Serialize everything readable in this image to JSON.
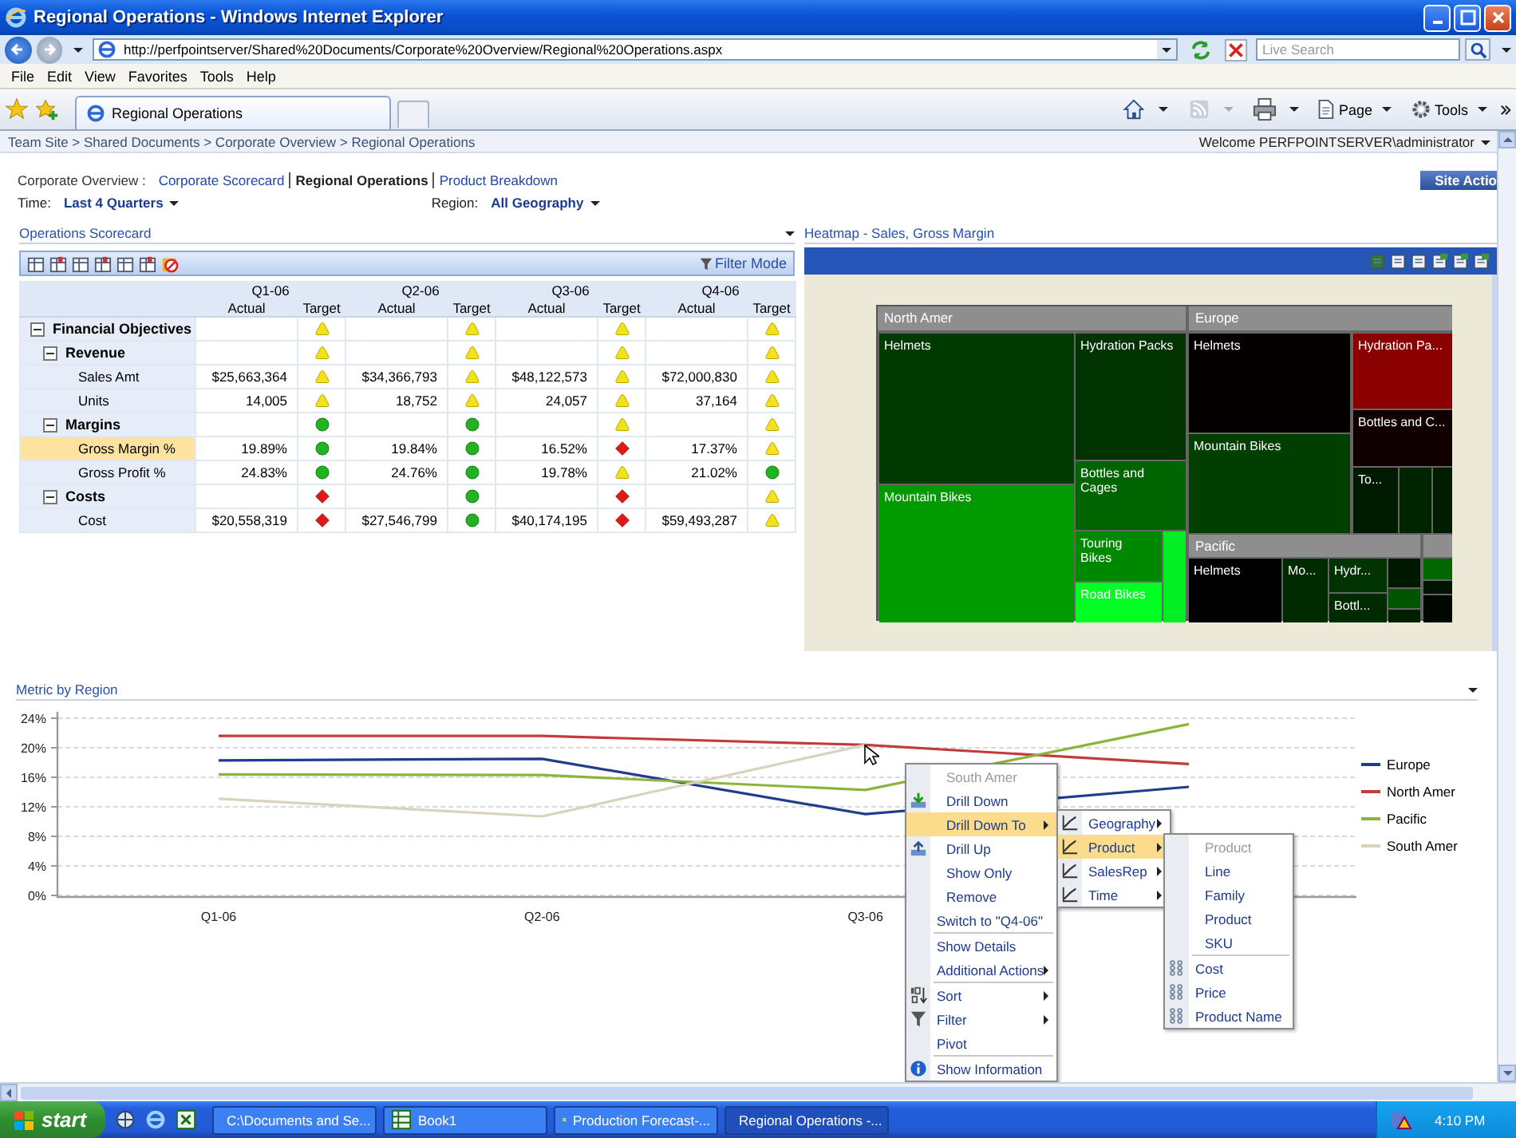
{
  "window": {
    "title": "Regional Operations - Windows Internet Explorer"
  },
  "address_bar": {
    "url": "http://perfpointserver/Shared%20Documents/Corporate%20Overview/Regional%20Operations.aspx"
  },
  "search": {
    "placeholder": "Live Search"
  },
  "menu": [
    "File",
    "Edit",
    "View",
    "Favorites",
    "Tools",
    "Help"
  ],
  "tabs": [
    {
      "label": "Regional Operations",
      "selected": true
    }
  ],
  "command_bar": [
    "Page",
    "Tools"
  ],
  "breadcrumb": "Team Site > Shared Documents > Corporate Overview > Regional Operations",
  "welcome": "Welcome PERFPOINTSERVER\\administrator",
  "site_actions": "Site Actio",
  "page_nav": {
    "label": "Corporate Overview :",
    "links": [
      {
        "label": "Corporate Scorecard",
        "selected": false
      },
      {
        "label": "Regional Operations",
        "selected": true
      },
      {
        "label": "Product Breakdown",
        "selected": false
      }
    ]
  },
  "filters": [
    {
      "label": "Time:",
      "value": "Last 4 Quarters"
    },
    {
      "label": "Region:",
      "value": "All Geography"
    }
  ],
  "scorecard": {
    "title": "Operations Scorecard",
    "filter_mode": "Filter Mode",
    "periods": [
      {
        "label": "Q1-06",
        "columns": [
          "Actual",
          "Target"
        ]
      },
      {
        "label": "Q2-06",
        "columns": [
          "Actual",
          "Target"
        ]
      },
      {
        "label": "Q3-06",
        "columns": [
          "Actual",
          "Target"
        ]
      },
      {
        "label": "Q4-06",
        "columns": [
          "Actual",
          "Target"
        ]
      }
    ],
    "rows": [
      {
        "label": "Financial Objectives",
        "expanded": true,
        "selected": false,
        "cells": [
          {
            "kind": "warning"
          },
          {
            "kind": "warning"
          },
          {
            "kind": "warning"
          },
          {
            "kind": "warning"
          }
        ],
        "children": [
          {
            "label": "Revenue",
            "expanded": true,
            "selected": false,
            "cells": [
              {
                "kind": "warning"
              },
              {
                "kind": "warning"
              },
              {
                "kind": "warning"
              },
              {
                "kind": "warning"
              }
            ],
            "children": [
              {
                "label": "Sales Amt",
                "selected": false,
                "cells": [
                  {
                    "actual": "$25,663,364",
                    "kind": "warning"
                  },
                  {
                    "actual": "$34,366,793",
                    "kind": "warning"
                  },
                  {
                    "actual": "$48,122,573",
                    "kind": "warning"
                  },
                  {
                    "actual": "$72,000,830",
                    "kind": "warning"
                  }
                ]
              },
              {
                "label": "Units",
                "selected": false,
                "cells": [
                  {
                    "actual": "14,005",
                    "kind": "warning"
                  },
                  {
                    "actual": "18,752",
                    "kind": "warning"
                  },
                  {
                    "actual": "24,057",
                    "kind": "warning"
                  },
                  {
                    "actual": "37,164",
                    "kind": "warning"
                  }
                ]
              }
            ]
          },
          {
            "label": "Margins",
            "expanded": true,
            "selected": false,
            "cells": [
              {
                "kind": "good"
              },
              {
                "kind": "good"
              },
              {
                "kind": "warning"
              },
              {
                "kind": "warning"
              }
            ],
            "children": [
              {
                "label": "Gross Margin %",
                "selected": true,
                "cells": [
                  {
                    "actual": "19.89%",
                    "kind": "good"
                  },
                  {
                    "actual": "19.84%",
                    "kind": "good"
                  },
                  {
                    "actual": "16.52%",
                    "kind": "bad"
                  },
                  {
                    "actual": "17.37%",
                    "kind": "warning"
                  }
                ]
              },
              {
                "label": "Gross Profit %",
                "selected": false,
                "cells": [
                  {
                    "actual": "24.83%",
                    "kind": "good"
                  },
                  {
                    "actual": "24.76%",
                    "kind": "good"
                  },
                  {
                    "actual": "19.78%",
                    "kind": "warning"
                  },
                  {
                    "actual": "21.02%",
                    "kind": "good"
                  }
                ]
              }
            ]
          },
          {
            "label": "Costs",
            "expanded": true,
            "selected": false,
            "cells": [
              {
                "kind": "bad"
              },
              {
                "kind": "good"
              },
              {
                "kind": "bad"
              },
              {
                "kind": "warning"
              }
            ],
            "children": [
              {
                "label": "Cost",
                "selected": false,
                "cells": [
                  {
                    "actual": "$20,558,319",
                    "kind": "bad"
                  },
                  {
                    "actual": "$27,546,799",
                    "kind": "good"
                  },
                  {
                    "actual": "$40,174,195",
                    "kind": "bad"
                  },
                  {
                    "actual": "$59,493,287",
                    "kind": "warning"
                  }
                ]
              }
            ]
          }
        ]
      }
    ]
  },
  "heatmap": {
    "title": "Heatmap - Sales, Gross Margin",
    "regions": [
      {
        "label": "North Amer",
        "cells": [
          {
            "label": "Helmets",
            "color": "#003a00"
          },
          {
            "label": "Hydration Packs",
            "color": "#003300"
          },
          {
            "label": "Bottles and Cages",
            "color": "#006400"
          },
          {
            "label": "Mountain Bikes",
            "color": "#009900"
          },
          {
            "label": "Touring Bikes",
            "color": "#008800"
          },
          {
            "color": "#00ee22"
          },
          {
            "label": "Road Bikes",
            "color": "#00ff22"
          }
        ]
      },
      {
        "label": "Europe",
        "cells": [
          {
            "label": "Helmets",
            "color": "#050000"
          },
          {
            "label": "Hydration Pa...",
            "color": "#8b0000"
          },
          {
            "label": "Bottles and C...",
            "color": "#100000"
          },
          {
            "label": "Mountain Bikes",
            "color": "#003f00"
          },
          {
            "label": "To...",
            "color": "#001a00"
          },
          {
            "color": "#002400"
          },
          {
            "color": "#001d00"
          }
        ]
      },
      {
        "label": "Pacific",
        "cells": [
          {
            "label": "Helmets",
            "color": "#000000"
          },
          {
            "label": "Mo...",
            "color": "#002a00"
          },
          {
            "label": "Hydr...",
            "color": "#003300"
          },
          {
            "color": "#001800"
          },
          {
            "color": "#005500"
          },
          {
            "label": "Bottl...",
            "color": "#002a00"
          },
          {
            "color": "#002000"
          }
        ]
      },
      {
        "cells": [
          {
            "color": "#006600"
          },
          {
            "color": "#001500"
          },
          {
            "color": "#000800"
          }
        ]
      }
    ]
  },
  "metric_chart": {
    "title": "Metric by Region",
    "chart_data": {
      "type": "line",
      "categories": [
        "Q1-06",
        "Q2-06",
        "Q3-06",
        null
      ],
      "ylim": [
        0,
        24
      ],
      "grid": true,
      "yticks": [
        {
          "value": 0,
          "label": "0%"
        },
        {
          "value": 4,
          "label": "4%"
        },
        {
          "value": 8,
          "label": "8%"
        },
        {
          "value": 12,
          "label": "12%"
        },
        {
          "value": 16,
          "label": "16%"
        },
        {
          "value": 20,
          "label": "20%"
        },
        {
          "value": 24,
          "label": "24%"
        }
      ],
      "series": [
        {
          "name": "Europe",
          "color": "#1f3d8c",
          "values": [
            18.3,
            18.5,
            11,
            14.7
          ]
        },
        {
          "name": "North Amer",
          "color": "#c23b3d",
          "values": [
            21.6,
            21.6,
            20.4,
            17.8
          ]
        },
        {
          "name": "Pacific",
          "color": "#8cb43c",
          "values": [
            16.4,
            16.3,
            14.3,
            23.2
          ]
        },
        {
          "name": "South Amer",
          "color": "#d9d3bd",
          "values": [
            13.1,
            10.7,
            20.4,
            null
          ]
        }
      ]
    }
  },
  "context_menus": [
    {
      "items": [
        {
          "kind": "header",
          "label": "South Amer"
        },
        {
          "kind": "item",
          "label": "Drill Down",
          "grouped": true,
          "submenu": false,
          "selected": false
        },
        {
          "kind": "item",
          "label": "Drill Down To",
          "grouped": true,
          "submenu": true,
          "selected": true
        },
        {
          "kind": "item",
          "label": "Drill Up",
          "grouped": true,
          "submenu": false,
          "selected": false
        },
        {
          "kind": "item",
          "label": "Show Only",
          "grouped": true,
          "submenu": false,
          "selected": false
        },
        {
          "kind": "item",
          "label": "Remove",
          "grouped": true,
          "submenu": false,
          "selected": false
        },
        {
          "kind": "item",
          "label": "Switch to \"Q4-06\"",
          "grouped": false,
          "submenu": false,
          "selected": false
        },
        {
          "kind": "separator"
        },
        {
          "kind": "item",
          "label": "Show Details",
          "grouped": false,
          "submenu": false,
          "selected": false
        },
        {
          "kind": "item",
          "label": "Additional Actions",
          "grouped": false,
          "submenu": true,
          "selected": false
        },
        {
          "kind": "separator"
        },
        {
          "kind": "item",
          "label": "Sort",
          "grouped": false,
          "submenu": true,
          "selected": false
        },
        {
          "kind": "item",
          "label": "Filter",
          "grouped": false,
          "submenu": true,
          "selected": false
        },
        {
          "kind": "item",
          "label": "Pivot",
          "grouped": false,
          "submenu": false,
          "selected": false
        },
        {
          "kind": "separator"
        },
        {
          "kind": "item",
          "label": "Show Information",
          "grouped": false,
          "submenu": false,
          "selected": false
        }
      ]
    },
    {
      "items": [
        {
          "kind": "item",
          "label": "Geography",
          "grouped": false,
          "submenu": true,
          "selected": false
        },
        {
          "kind": "item",
          "label": "Product",
          "grouped": false,
          "submenu": true,
          "selected": true
        },
        {
          "kind": "item",
          "label": "SalesRep",
          "grouped": false,
          "submenu": true,
          "selected": false
        },
        {
          "kind": "item",
          "label": "Time",
          "grouped": false,
          "submenu": true,
          "selected": false
        }
      ]
    },
    {
      "items": [
        {
          "kind": "header",
          "label": "Product"
        },
        {
          "kind": "item",
          "label": "Line",
          "grouped": true,
          "submenu": false,
          "selected": false
        },
        {
          "kind": "item",
          "label": "Family",
          "grouped": true,
          "submenu": false,
          "selected": false
        },
        {
          "kind": "item",
          "label": "Product",
          "grouped": true,
          "submenu": false,
          "selected": false
        },
        {
          "kind": "item",
          "label": "SKU",
          "grouped": true,
          "submenu": false,
          "selected": false
        },
        {
          "kind": "separator"
        },
        {
          "kind": "item",
          "label": "Cost",
          "grouped": false,
          "submenu": false,
          "selected": false
        },
        {
          "kind": "item",
          "label": "Price",
          "grouped": false,
          "submenu": false,
          "selected": false
        },
        {
          "kind": "item",
          "label": "Product Name",
          "grouped": false,
          "submenu": false,
          "selected": false
        }
      ]
    }
  ],
  "taskbar": {
    "start": "start",
    "tasks": [
      {
        "label": "C:\\Documents and Se...",
        "selected": false
      },
      {
        "label": "Book1",
        "selected": false
      },
      {
        "label": "Production Forecast-...",
        "selected": false
      },
      {
        "label": "Regional Operations -...",
        "selected": true
      }
    ],
    "clock": "4:10 PM"
  }
}
